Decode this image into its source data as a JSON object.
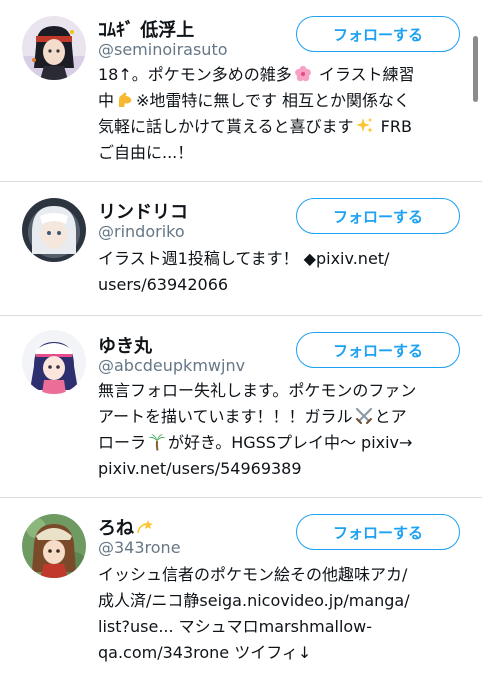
{
  "follow_label": "フォローする",
  "accent_color": "#1da1f2",
  "users": [
    {
      "name": "ｺﾑｷﾞ 低浮上",
      "handle": "@seminoirasuto",
      "bio_lines": [
        "18↑。ポケモン多めの雑多",
        "イラスト練習",
        "中",
        "※地雷特に無しです 相互とか関係なく",
        "気軽に話しかけて貰えると喜びます",
        "FRB",
        "ご自由に...！"
      ]
    },
    {
      "name": "リンドリコ",
      "handle": "@rindoriko",
      "bio_lines": [
        "イラスト週1投稿してます！ ◆pixiv.net/",
        "users/63942066"
      ]
    },
    {
      "name": "ゆき丸",
      "handle": "@abcdeupkmwjnv",
      "bio_lines": [
        "無言フォロー失礼します。ポケモンのファン",
        "アートを描いています！！！ガラル",
        "とア",
        "ローラ",
        "が好き。HGSSプレイ中〜 pixiv→",
        "pixiv.net/users/54969389"
      ]
    },
    {
      "name": "ろね",
      "handle": "@343rone",
      "bio_lines": [
        "イッシュ信者のポケモン絵その他趣味アカ/",
        "成人済/ニコ静seiga.nicovideo.jp/manga/",
        "list?use... マシュマロmarshmallow-",
        "qa.com/343rone ツイフィ↓"
      ]
    }
  ]
}
